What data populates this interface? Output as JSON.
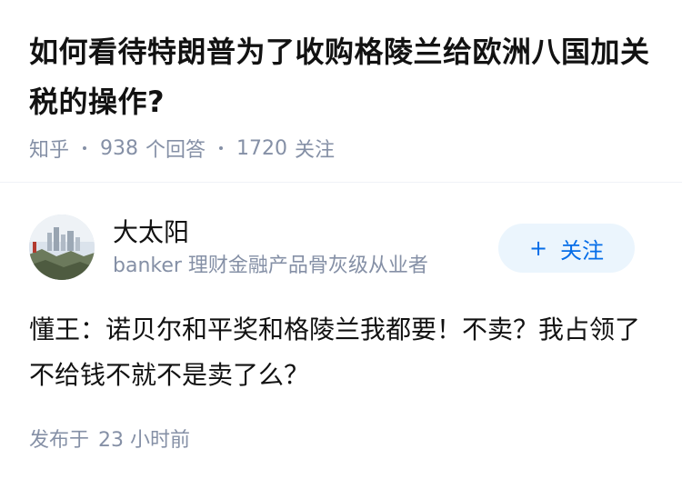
{
  "question": {
    "title": "如何看待特朗普为了收购格陵兰给欧洲八国加关税的操作?",
    "source": "知乎",
    "answer_count": "938",
    "answer_label": "个回答",
    "follow_count": "1720",
    "follow_label": "关注"
  },
  "answer": {
    "author_name": "大太阳",
    "author_bio": "banker 理财金融产品骨灰级从业者",
    "follow_button": "关注",
    "follow_icon": "plus-icon",
    "content": "懂王：诺贝尔和平奖和格陵兰我都要！不卖？我占领了不给钱不就不是卖了么？",
    "published_label": "发布于",
    "published_time": "23 小时前"
  },
  "colors": {
    "accent": "#056de8",
    "accent_bg": "#ebf5fd",
    "muted": "#8590a6",
    "text": "#121212"
  }
}
